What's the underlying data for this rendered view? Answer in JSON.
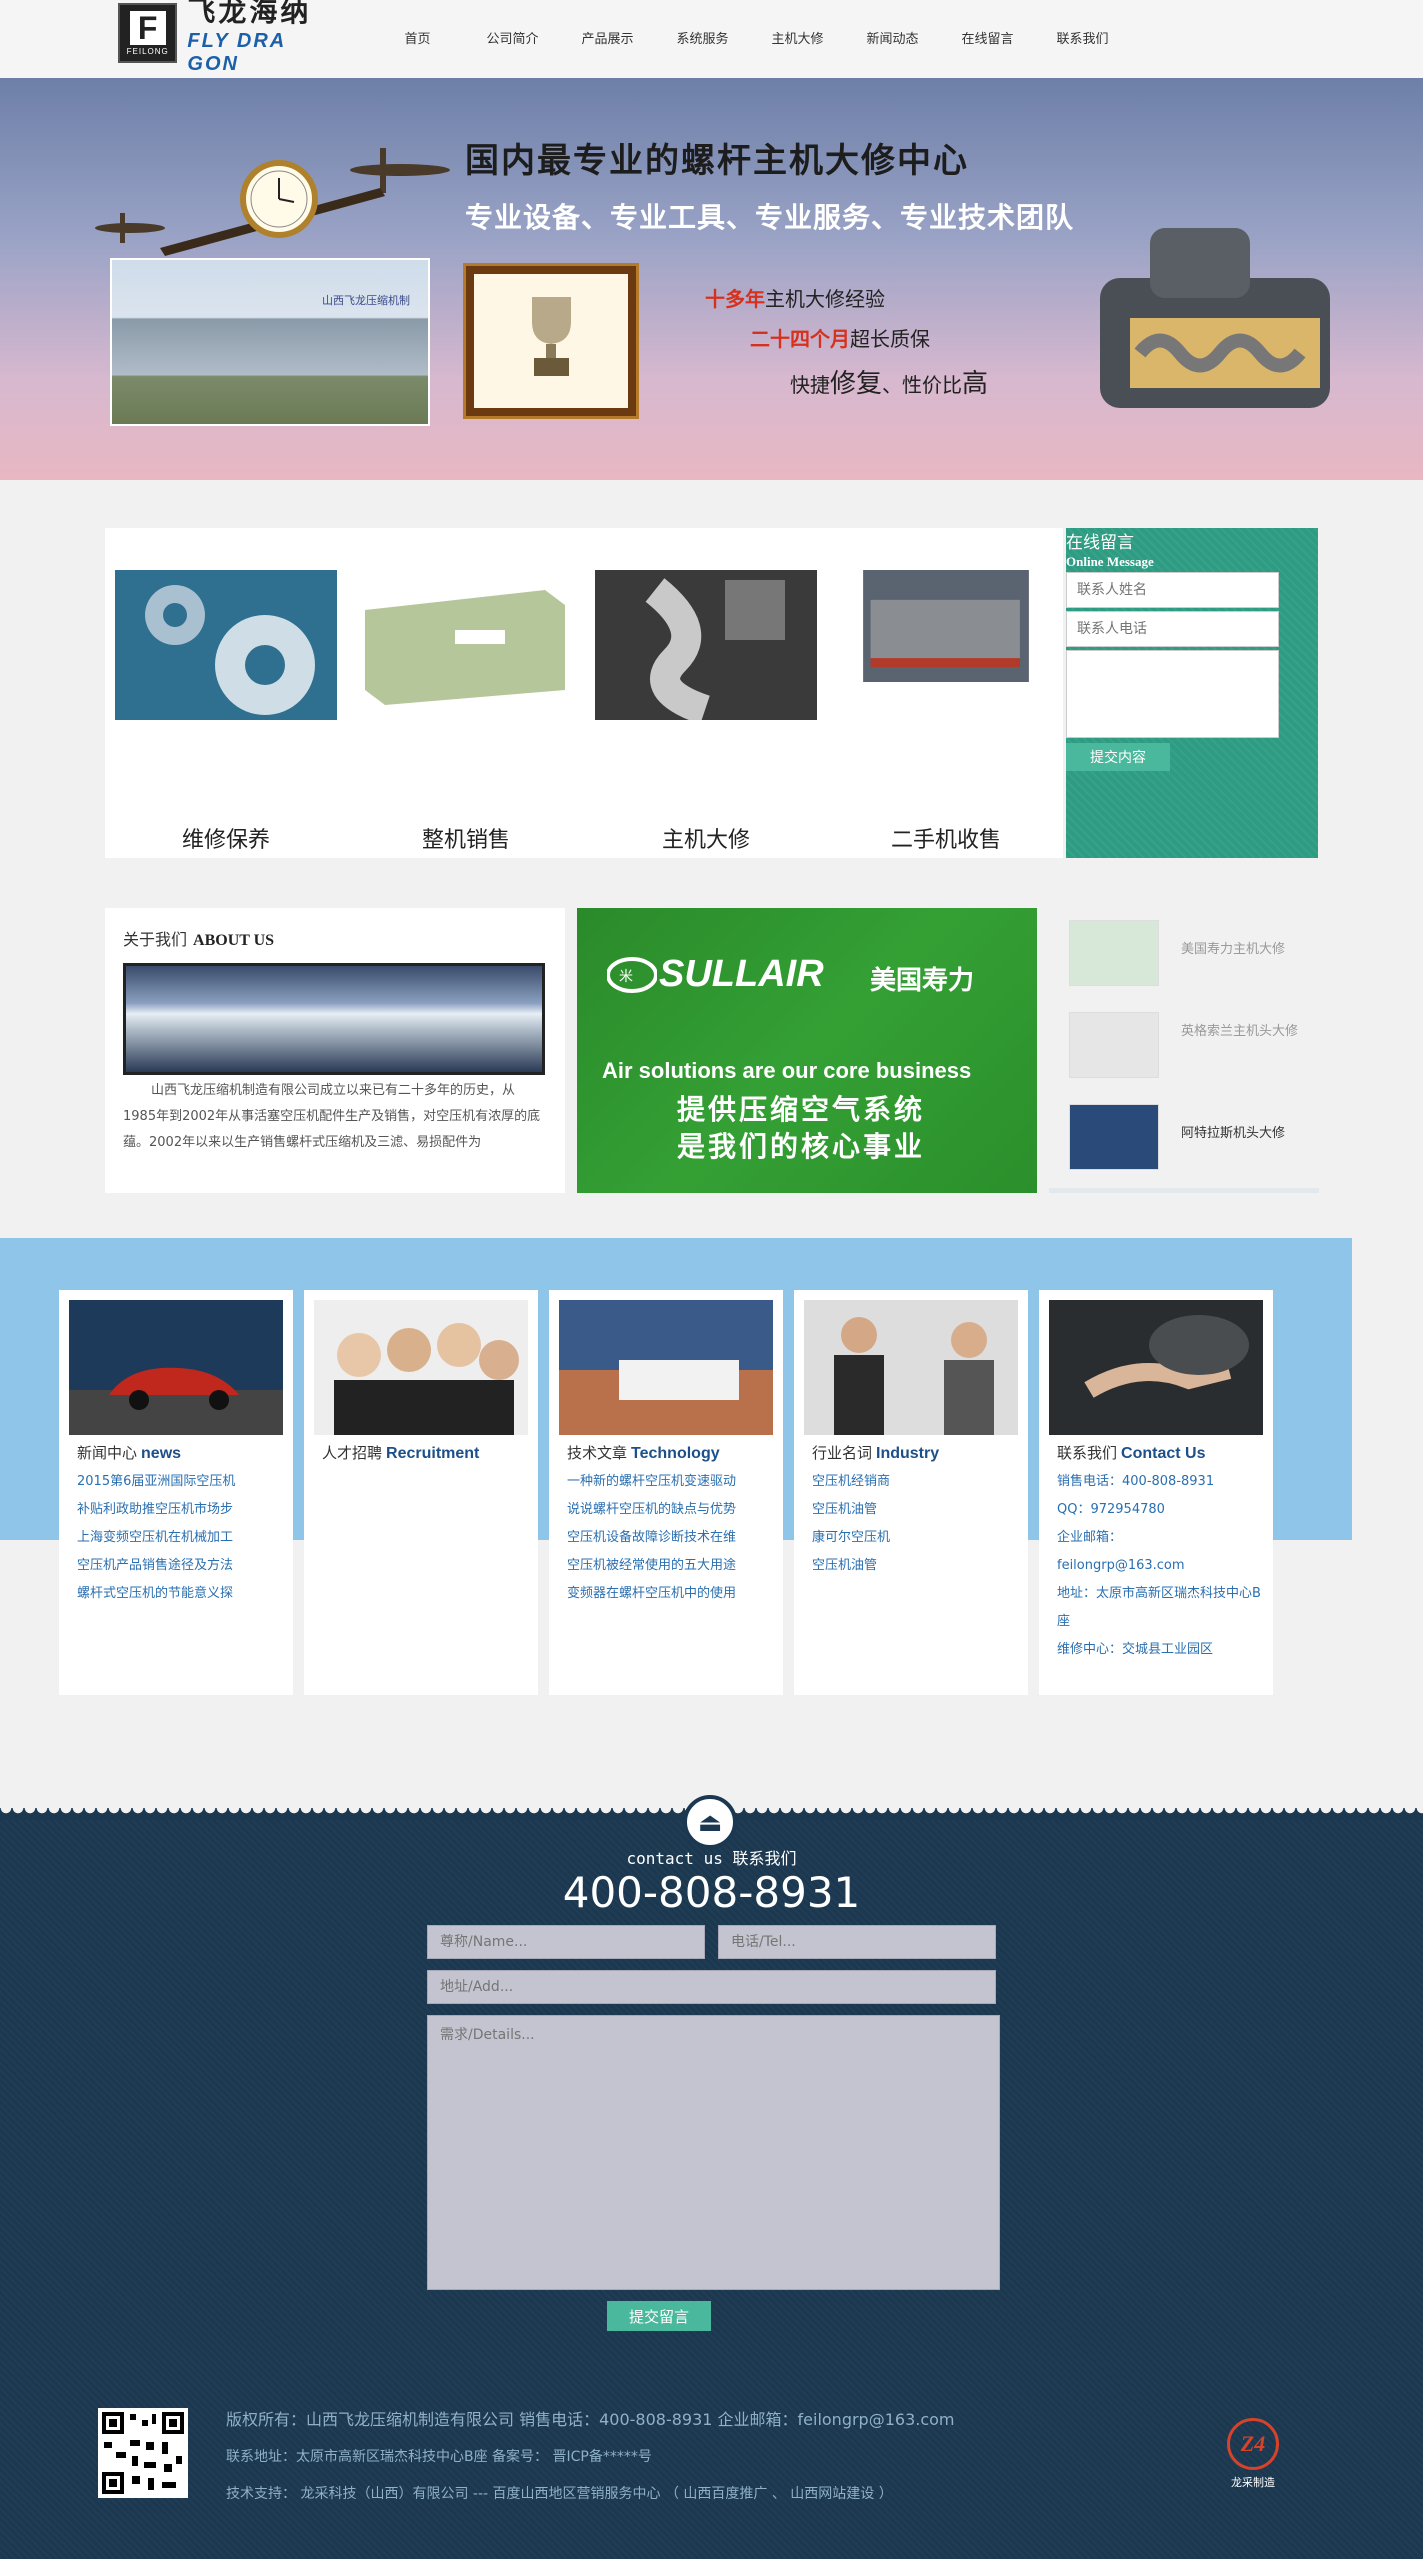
{
  "header": {
    "logo_cn": "飞龙海纳",
    "logo_en": "FLY DRA GON",
    "logo_mark": "FEILONG",
    "nav": [
      "首页",
      "公司简介",
      "产品展示",
      "系统服务",
      "主机大修",
      "新闻动态",
      "在线留言",
      "联系我们"
    ]
  },
  "banner": {
    "headline": "国内最专业的螺杆主机大修中心",
    "subhead": "专业设备、专业工具、专业服务、专业技术团队",
    "line1_red": "十多年",
    "line1_rest": "主机大修经验",
    "line2_red": "二十四个月",
    "line2_rest": "超长质保",
    "line3_a": "快捷",
    "line3_b": "修复",
    "line3_c": "、性价比",
    "line3_d": "高",
    "building_sign": "山西飞龙压缩机制"
  },
  "services": [
    {
      "label": "维修保养",
      "icon": "gears-image"
    },
    {
      "label": "整机销售",
      "icon": "compressor-image"
    },
    {
      "label": "主机大修",
      "icon": "screw-rotor-image"
    },
    {
      "label": "二手机收售",
      "icon": "truck-image"
    }
  ],
  "message_box": {
    "title": "在线留言",
    "title_en": "Online Message",
    "name_placeholder": "联系人姓名",
    "phone_placeholder": "联系人电话",
    "submit": "提交内容"
  },
  "about": {
    "title": "关于我们",
    "title_en": "ABOUT US",
    "text": "山西飞龙压缩机制造有限公司成立以来已有二十多年的历史，从1985年到2002年从事活塞空压机配件生产及销售，对空压机有浓厚的底蕴。2002年以来以生产销售螺杆式压缩机及三滤、易损配件为"
  },
  "sullair": {
    "brand": "SULLAIR",
    "brand_cn": "美国寿力",
    "slogan_en": "Air solutions are our core business",
    "slogan_cn1": "提供压缩空气系统",
    "slogan_cn2": "是我们的核心事业"
  },
  "products": [
    {
      "name": "美国寿力主机大修"
    },
    {
      "name": "英格索兰主机头大修"
    },
    {
      "name": "阿特拉斯机头大修"
    }
  ],
  "cards": [
    {
      "title": "新闻中心",
      "title_en": "news",
      "items": [
        "2015第6届亚洲国际空压机",
        "补贴利政助推空压机市场步",
        "上海变频空压机在机械加工",
        "空压机产品销售途径及方法",
        "螺杆式空压机的节能意义探"
      ]
    },
    {
      "title": "人才招聘",
      "title_en": "Recruitment",
      "items": []
    },
    {
      "title": "技术文章",
      "title_en": "Technology",
      "items": [
        "一种新的螺杆空压机变速驱动",
        "说说螺杆空压机的缺点与优势",
        "空压机设备故障诊断技术在维",
        "空压机被经常使用的五大用途",
        "变频器在螺杆空压机中的使用"
      ]
    },
    {
      "title": "行业名词",
      "title_en": "Industry",
      "items": [
        "空压机经销商",
        "空压机油管",
        "康可尔空压机",
        "空压机油管"
      ]
    },
    {
      "title": "联系我们",
      "title_en": "Contact Us",
      "items": [
        "销售电话：400-808-8931",
        "QQ：972954780",
        "企业邮箱：",
        "feilongrp@163.com",
        "地址：太原市高新区瑞杰科技中心B座",
        "维修中心：交城县工业园区"
      ]
    }
  ],
  "footer": {
    "contact_en": "contact us",
    "contact_cn": "联系我们",
    "phone": "400-808-8931",
    "name_placeholder": "尊称/Name...",
    "tel_placeholder": "电话/Tel...",
    "addr_placeholder": "地址/Add...",
    "details_placeholder": "需求/Details...",
    "submit": "提交留言",
    "copyright": "版权所有：山西飞龙压缩机制造有限公司  销售电话：400-808-8931  企业邮箱：feilongrp@163.com",
    "address": "联系地址：太原市高新区瑞杰科技中心B座  备案号： 晋ICP备*****号",
    "tech": "技术支持： 龙采科技（山西）有限公司 --- 百度山西地区营销服务中心 （ 山西百度推广 、 山西网站建设 ）",
    "badge_text": "龙采制造",
    "badge_mark": "Z4"
  }
}
